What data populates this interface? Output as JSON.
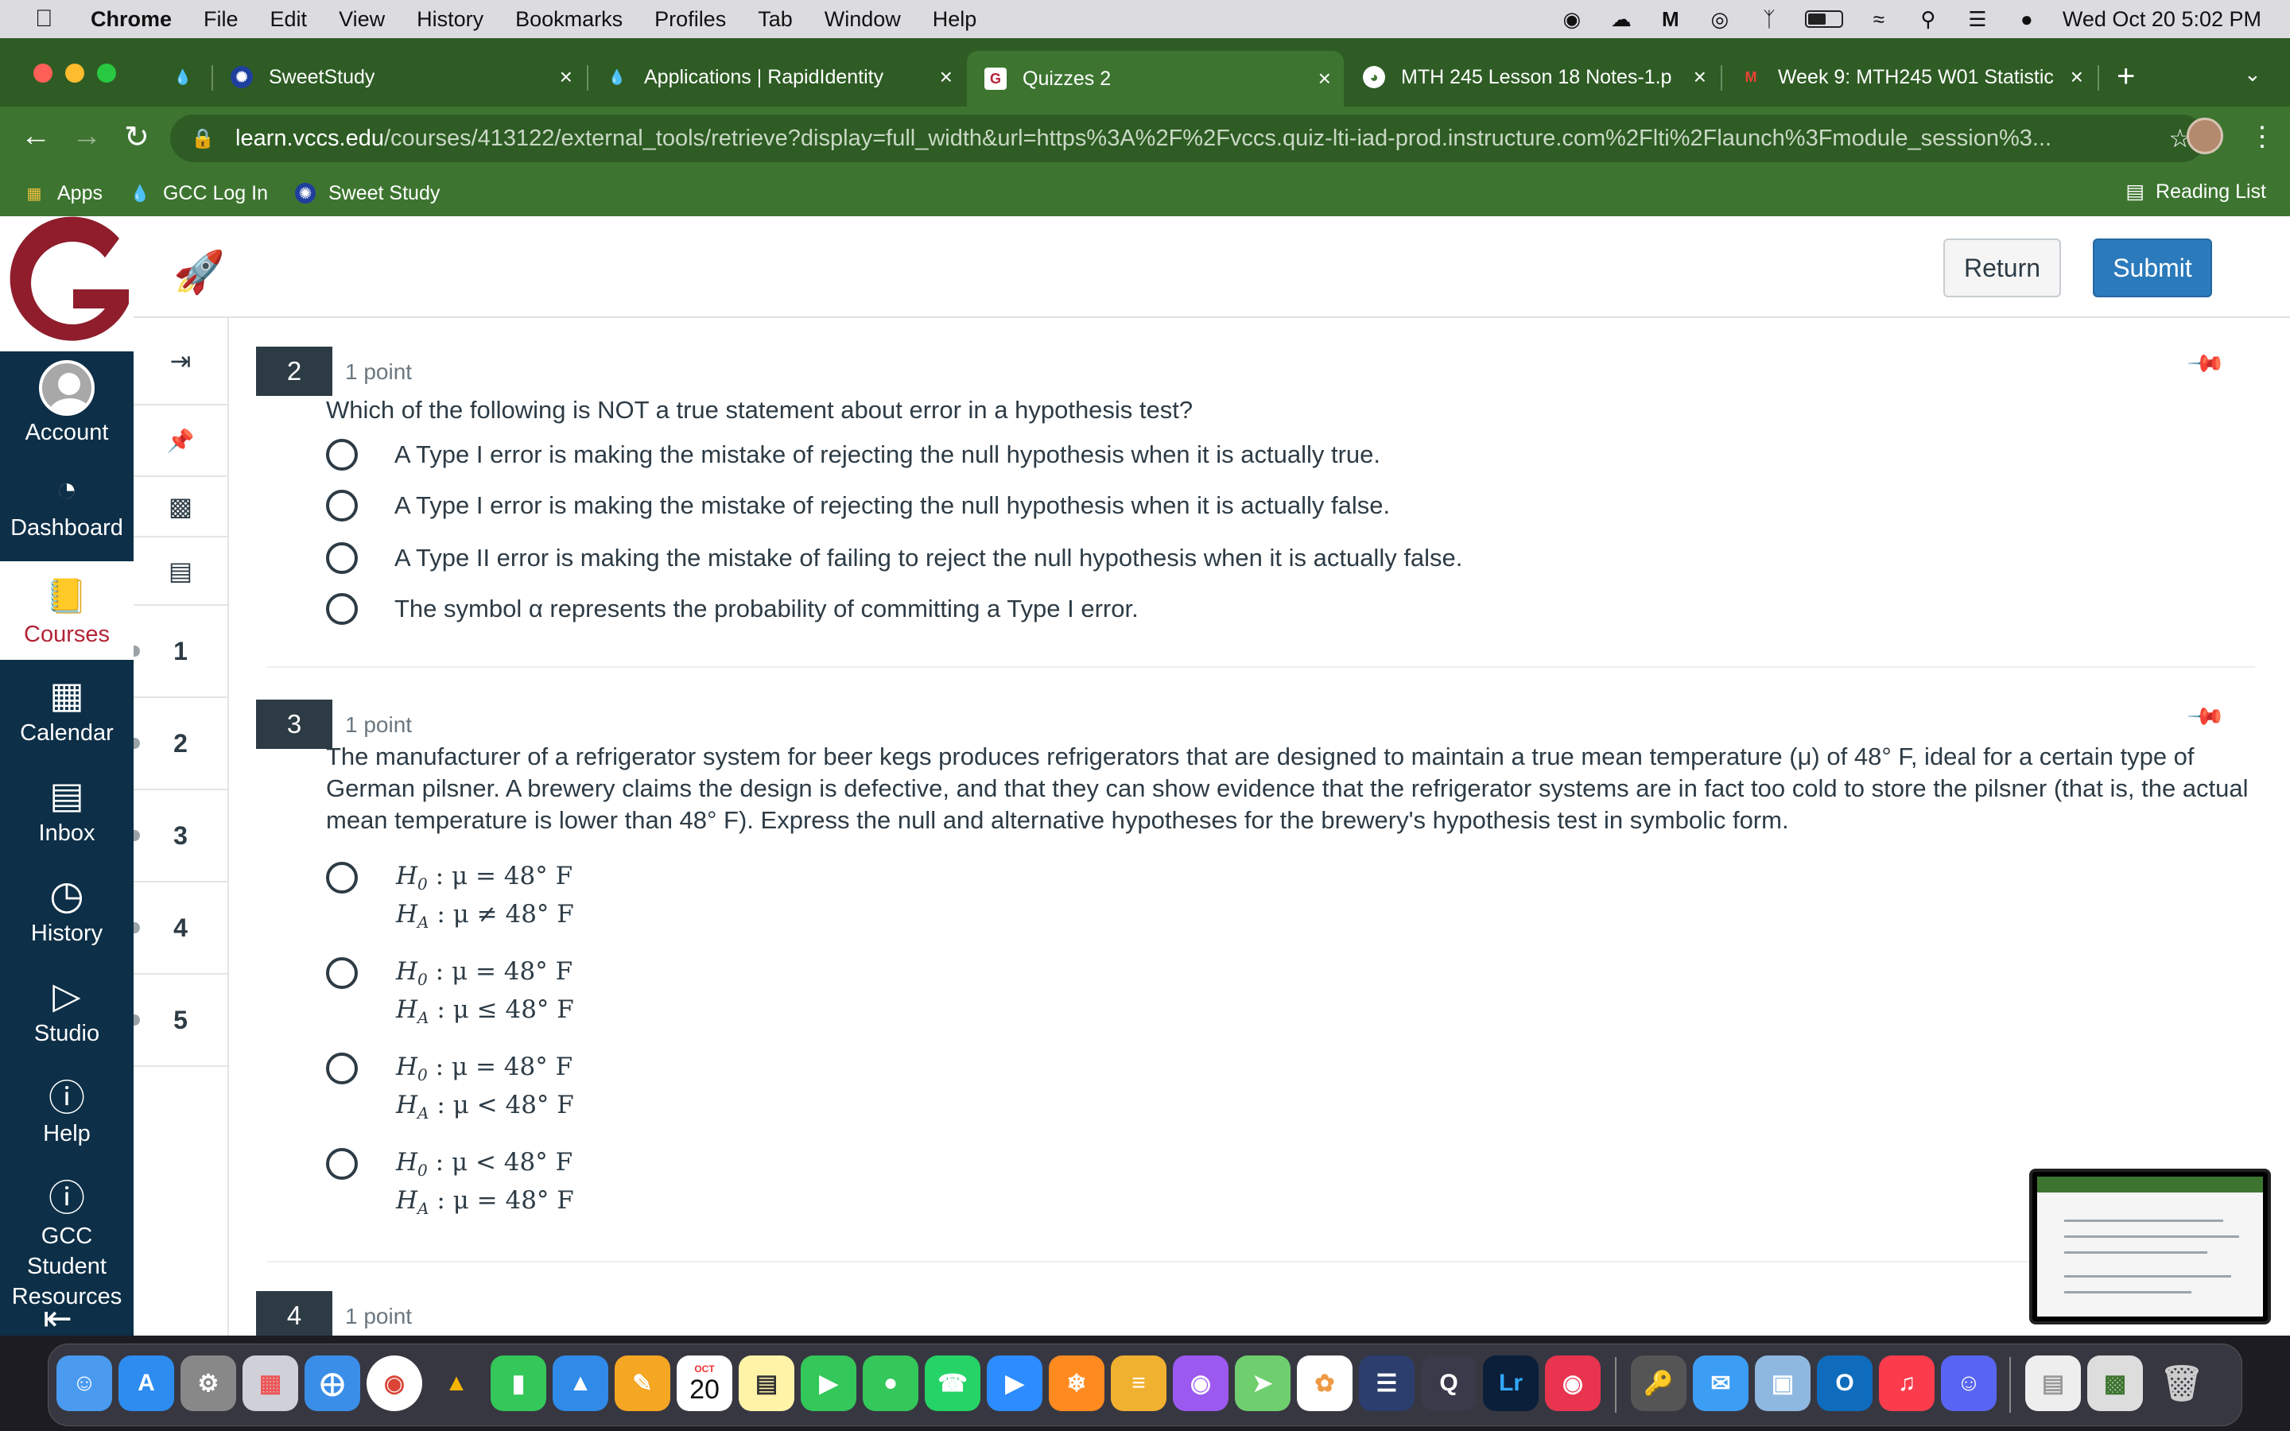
{
  "menubar": {
    "app": "Chrome",
    "items": [
      "File",
      "Edit",
      "View",
      "History",
      "Bookmarks",
      "Profiles",
      "Tab",
      "Window",
      "Help"
    ],
    "datetime": "Wed Oct 20  5:02 PM"
  },
  "tabs": [
    {
      "label": "SweetStudy"
    },
    {
      "label": "Applications | RapidIdentity"
    },
    {
      "label": "Quizzes 2"
    },
    {
      "label": "MTH 245 Lesson 18 Notes-1.p"
    },
    {
      "label": "Week 9: MTH245 W01 Statistic"
    }
  ],
  "omnibox": {
    "host": "learn.vccs.edu",
    "path": "/courses/413122/external_tools/retrieve?display=full_width&url=https%3A%2F%2Fvccs.quiz-lti-iad-prod.instructure.com%2Flti%2Flaunch%3Fmodule_session%3..."
  },
  "bookmarks": [
    {
      "label": "Apps"
    },
    {
      "label": "GCC Log In"
    },
    {
      "label": "Sweet Study"
    }
  ],
  "reading_list": "Reading List",
  "header": {
    "logo_letter": "G",
    "return_label": "Return",
    "submit_label": "Submit"
  },
  "global_nav": [
    {
      "label": "Account"
    },
    {
      "label": "Dashboard"
    },
    {
      "label": "Courses"
    },
    {
      "label": "Calendar"
    },
    {
      "label": "Inbox"
    },
    {
      "label": "History"
    },
    {
      "label": "Studio"
    },
    {
      "label": "Help"
    },
    {
      "label": "GCC Student Resources"
    }
  ],
  "quiz_nav": {
    "numbers": [
      "1",
      "2",
      "3",
      "4",
      "5"
    ]
  },
  "questions": [
    {
      "number": "2",
      "points": "1 point",
      "text": "Which of the following is NOT a true statement about error in a hypothesis test?",
      "options": [
        "A Type I error is making the mistake of rejecting the null hypothesis when it is actually true.",
        "A Type I error is making the mistake of rejecting the null hypothesis when it is actually false.",
        "A Type II error is making the mistake of failing to reject the null hypothesis when it is actually false.",
        "The symbol α represents the probability of committing a Type I error."
      ]
    },
    {
      "number": "3",
      "points": "1 point",
      "text": "The manufacturer of a refrigerator system for beer kegs produces refrigerators that are designed to maintain a true mean temperature (μ) of 48° F, ideal for a certain type of German pilsner. A brewery claims the design is defective, and that they can show evidence that the refrigerator systems are in fact too cold to store the pilsner (that is, the actual mean temperature is lower than 48° F). Express the null and alternative hypotheses for the brewery's hypothesis test in symbolic form.",
      "options": [
        {
          "h0": ": μ = 48° F",
          "ha": ": μ ≠ 48° F"
        },
        {
          "h0": ": μ = 48° F",
          "ha": ": μ ≤ 48° F"
        },
        {
          "h0": ": μ = 48° F",
          "ha": ": μ < 48° F"
        },
        {
          "h0": ": μ < 48° F",
          "ha": ": μ = 48° F"
        }
      ]
    },
    {
      "number": "4",
      "points": "1 point"
    }
  ],
  "hyp_symbols": {
    "h": "H",
    "sub0": "0",
    "subA": "A"
  },
  "dock": {
    "calendar_month": "OCT",
    "calendar_day": "20",
    "lr": "Lr"
  }
}
